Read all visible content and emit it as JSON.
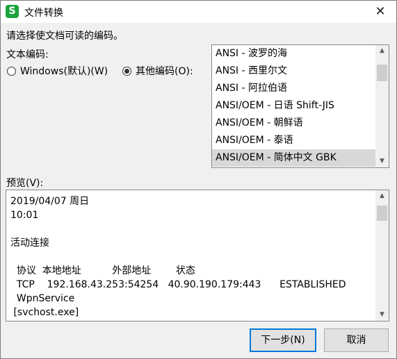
{
  "window": {
    "title": "文件转换",
    "app_icon_letter": "S",
    "close_glyph": "✕"
  },
  "prompt": "请选择使文档可读的编码。",
  "encoding_group": {
    "label": "文本编码:",
    "windows_option": "Windows(默认)(W)",
    "other_option": "其他编码(O):",
    "selected": "other"
  },
  "encoding_list": {
    "items": [
      "ANSI - 波罗的海",
      "ANSI - 西里尔文",
      "ANSI - 阿拉伯语",
      "ANSI/OEM - 日语 Shift-JIS",
      "ANSI/OEM - 朝鲜语",
      "ANSI/OEM - 泰语",
      "ANSI/OEM - 简体中文 GBK"
    ],
    "selected_index": 6
  },
  "preview": {
    "label": "预览(V):",
    "lines": [
      "2019/04/07 周日",
      "10:01",
      "",
      "活动连接",
      "",
      "  协议  本地地址          外部地址        状态",
      "  TCP    192.168.43.253:54254   40.90.190.179:443      ESTABLISHED",
      "  WpnService",
      " [svchost.exe]"
    ]
  },
  "buttons": {
    "next": "下一步(N)",
    "cancel": "取消"
  },
  "colors": {
    "accent": "#0078d7",
    "app_icon": "#1aa43e",
    "selection": "#d8d8d8"
  }
}
